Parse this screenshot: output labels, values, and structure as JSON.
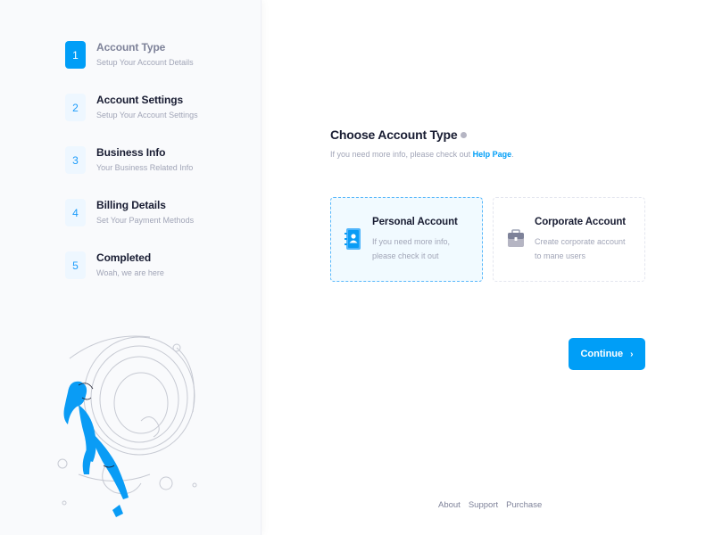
{
  "steps": [
    {
      "num": "1",
      "title": "Account Type",
      "subtitle": "Setup Your Account Details",
      "active": true
    },
    {
      "num": "2",
      "title": "Account Settings",
      "subtitle": "Setup Your Account Settings",
      "active": false
    },
    {
      "num": "3",
      "title": "Business Info",
      "subtitle": "Your Business Related Info",
      "active": false
    },
    {
      "num": "4",
      "title": "Billing Details",
      "subtitle": "Set Your Payment Methods",
      "active": false
    },
    {
      "num": "5",
      "title": "Completed",
      "subtitle": "Woah, we are here",
      "active": false
    }
  ],
  "main": {
    "title": "Choose Account Type",
    "subtitle_prefix": "If you need more info, please check out ",
    "subtitle_link": "Help Page",
    "subtitle_suffix": "."
  },
  "cards": {
    "personal": {
      "title": "Personal Account",
      "desc": "If you need more info, please check it out"
    },
    "corporate": {
      "title": "Corporate Account",
      "desc": "Create corporate account to mane users"
    }
  },
  "actions": {
    "continue_label": "Continue",
    "continue_icon": "›"
  },
  "footer": {
    "about": "About",
    "support": "Support",
    "purchase": "Purchase"
  },
  "colors": {
    "primary": "#009ef7",
    "sidebar_bg": "#f9fafc",
    "selected_card_bg": "#f1faff"
  },
  "icons": {
    "personal": "contact-book-icon",
    "corporate": "briefcase-icon",
    "info": "info-circle-icon"
  }
}
